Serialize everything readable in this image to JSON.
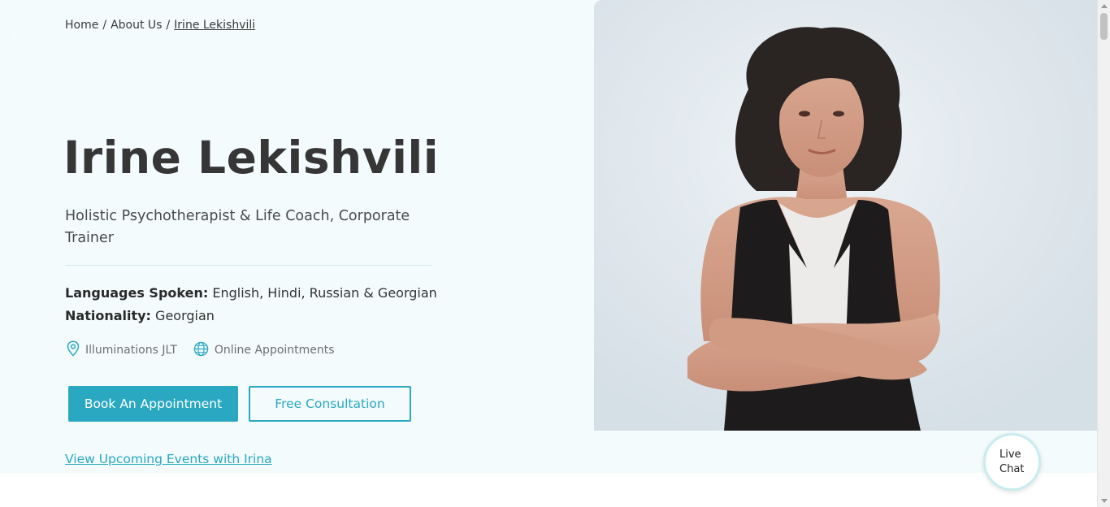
{
  "breadcrumb": {
    "home": "Home",
    "separator": "/",
    "about": "About Us",
    "current": "Irine Lekishvili"
  },
  "corner_mark": "«",
  "profile": {
    "name": "Irine Lekishvili",
    "title": "Holistic Psychotherapist & Life Coach, Corporate Trainer",
    "languages_label": "Languages Spoken:",
    "languages_value": "English, Hindi, Russian & Georgian",
    "nationality_label": "Nationality:",
    "nationality_value": "Georgian",
    "location": "Illuminations JLT",
    "location_icon": "map-pin-icon",
    "mode": "Online Appointments",
    "mode_icon": "globe-icon"
  },
  "actions": {
    "book": "Book An Appointment",
    "consult": "Free Consultation",
    "events_link": "View Upcoming Events with Irina"
  },
  "chat": {
    "line1": "Live",
    "line2": "Chat"
  },
  "colors": {
    "accent": "#2aa8c2",
    "hero_bg": "#f3fbfc",
    "heading": "#363636"
  }
}
